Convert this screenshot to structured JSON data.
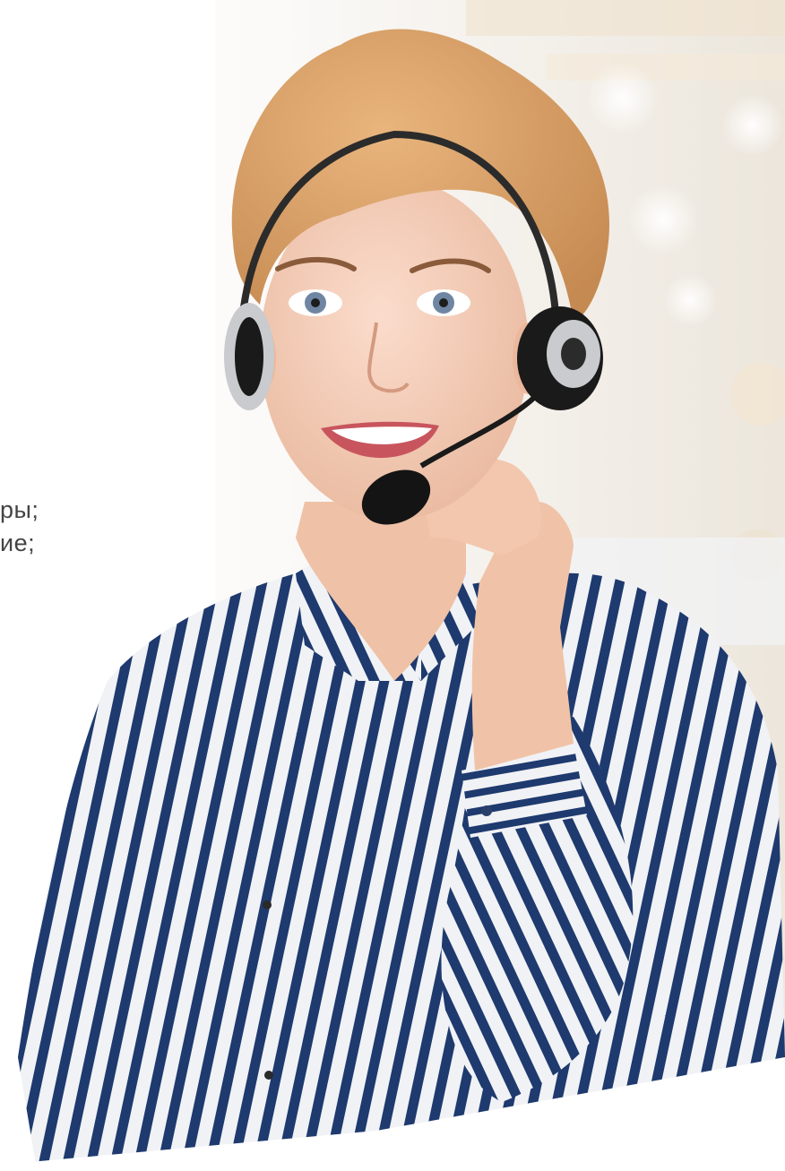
{
  "image": {
    "subject": "smiling-woman-with-headset",
    "colors": {
      "background_white": "#ffffff",
      "blur_highlight": "#f6f1e8",
      "hair": "#d49a5f",
      "skin": "#f2c8b0",
      "shirt_stripe_blue": "#1e3a6e",
      "shirt_stripe_white": "#f1f2f5",
      "headset_black": "#1a1a1a",
      "headset_silver": "#c9cbce",
      "text_grey": "#444444"
    }
  },
  "cropped_list": {
    "items": [
      "ры;",
      "ие;"
    ]
  }
}
